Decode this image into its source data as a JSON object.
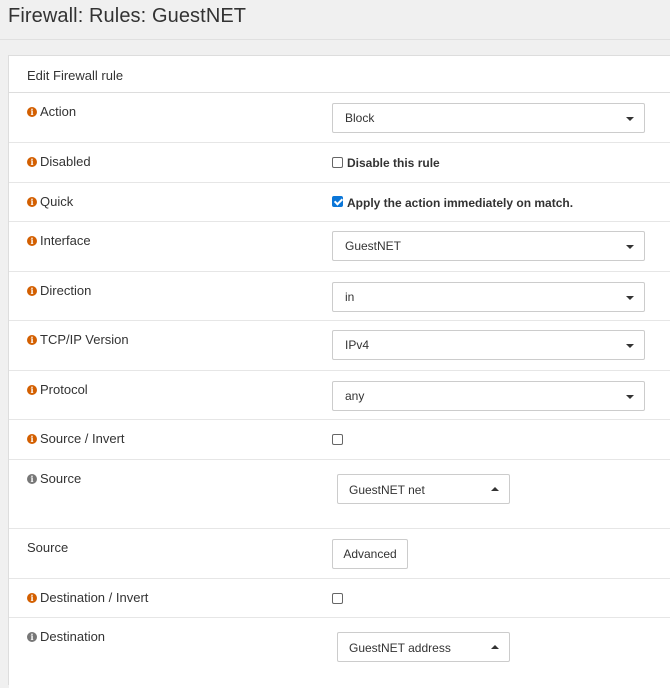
{
  "page": {
    "title": "Firewall: Rules: GuestNET"
  },
  "panel": {
    "heading": "Edit Firewall rule"
  },
  "rows": {
    "action": {
      "label": "Action",
      "value": "Block"
    },
    "disabled": {
      "label": "Disabled",
      "checkbox_label": "Disable this rule",
      "checked": false
    },
    "quick": {
      "label": "Quick",
      "checkbox_label": "Apply the action immediately on match.",
      "checked": true
    },
    "interface": {
      "label": "Interface",
      "value": "GuestNET"
    },
    "direction": {
      "label": "Direction",
      "value": "in"
    },
    "tcpip": {
      "label": "TCP/IP Version",
      "value": "IPv4"
    },
    "protocol": {
      "label": "Protocol",
      "value": "any"
    },
    "source_invert": {
      "label": "Source / Invert",
      "checked": false
    },
    "source": {
      "label": "Source",
      "value": "GuestNET net"
    },
    "source_advanced": {
      "label": "Source",
      "button_label": "Advanced"
    },
    "destination_invert": {
      "label": "Destination / Invert",
      "checked": false
    },
    "destination": {
      "label": "Destination",
      "value": "GuestNET address"
    }
  },
  "colors": {
    "info_icon": "#d35f00",
    "info_icon_grey": "#777777",
    "checkbox_checked": "#0b76d8"
  },
  "icons": {
    "info": "info-circle-icon",
    "dropdown": "chevron-down-icon",
    "dropdown_open": "chevron-up-icon"
  }
}
